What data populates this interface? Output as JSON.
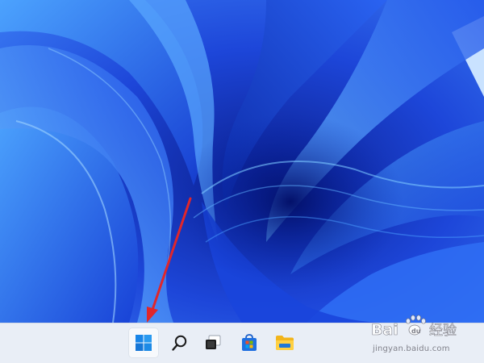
{
  "taskbar": {
    "items": [
      {
        "id": "start",
        "icon": "windows-logo-icon",
        "active": true
      },
      {
        "id": "search",
        "icon": "search-icon",
        "active": false
      },
      {
        "id": "task-view",
        "icon": "task-view-icon",
        "active": false
      },
      {
        "id": "store",
        "icon": "microsoft-store-icon",
        "active": false
      },
      {
        "id": "file-explorer",
        "icon": "folder-icon",
        "active": false
      }
    ]
  },
  "watermark": {
    "brand": "Baidu",
    "brand_cn": "经验",
    "url": "jingyan.baidu.com"
  },
  "colors": {
    "wallpaper_base": "#1e4fe0",
    "taskbar_bg": "#e9eef6",
    "annotation_arrow": "#e0262b",
    "start_blue": "#1a86e8"
  }
}
